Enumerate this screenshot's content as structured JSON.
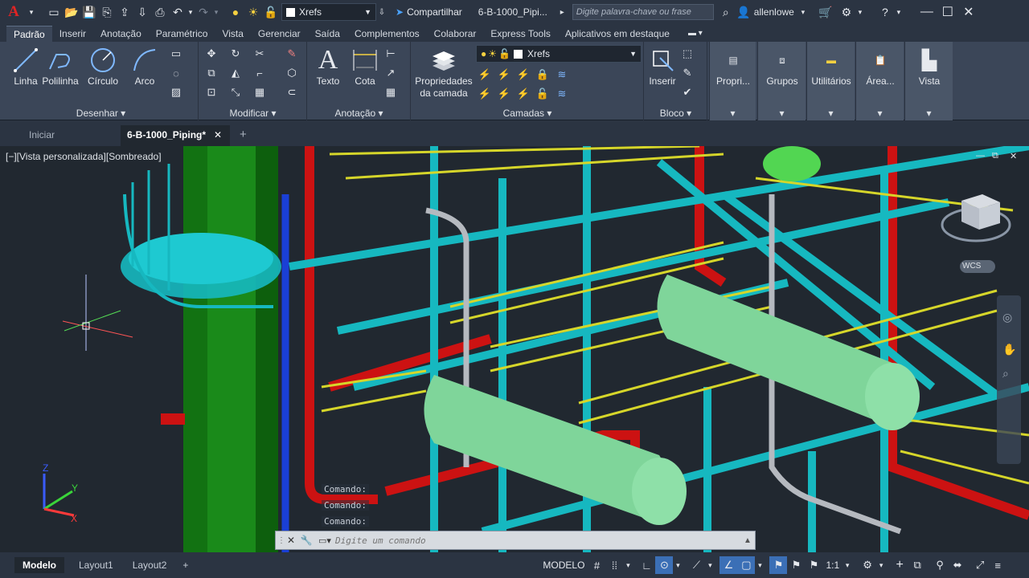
{
  "app": {
    "logo": "A",
    "title": "6-B-1000_Pipi...",
    "search_placeholder": "Digite palavra-chave ou frase",
    "user": "allenlowe",
    "share": "Compartilhar"
  },
  "layer": {
    "current": "Xrefs"
  },
  "ribbon": {
    "tabs": [
      "Padrão",
      "Inserir",
      "Anotação",
      "Paramétrico",
      "Vista",
      "Gerenciar",
      "Saída",
      "Complementos",
      "Colaborar",
      "Express Tools",
      "Aplicativos em destaque"
    ],
    "active_tab": "Padrão",
    "panels": {
      "draw": {
        "title": "Desenhar",
        "tools": [
          "Linha",
          "Polilinha",
          "Círculo",
          "Arco"
        ]
      },
      "modify": {
        "title": "Modificar"
      },
      "annotation": {
        "title": "Anotação",
        "tools": [
          "Texto",
          "Cota"
        ]
      },
      "layers": {
        "title": "Camadas",
        "properties": "Propriedades da camada",
        "current": "Xrefs"
      },
      "block": {
        "title": "Bloco",
        "insert": "Inserir"
      },
      "extra": [
        "Propri...",
        "Grupos",
        "Utilitários",
        "Área...",
        "Vista"
      ]
    }
  },
  "doc_tabs": [
    {
      "label": "Iniciar"
    },
    {
      "label": "6-B-1000_Piping*"
    }
  ],
  "viewport": {
    "label": "[−][Vista personalizada][Sombreado]",
    "wcs": "WCS"
  },
  "command": {
    "history": [
      "Comando:",
      "Comando:",
      "Comando:"
    ],
    "placeholder": "Digite um comando"
  },
  "status": {
    "layouts": [
      "Modelo",
      "Layout1",
      "Layout2"
    ],
    "mode": "MODELO",
    "scale": "1:1"
  },
  "colors": {
    "ribbon": "#3b4658",
    "titlebar": "#2b3442",
    "viewport": "#212830",
    "steel": "#16b8c0",
    "rail": "#d6d62a",
    "pipe_red": "#cc1212",
    "vessel": "#7fd59a",
    "column": "#1a8a1a"
  }
}
